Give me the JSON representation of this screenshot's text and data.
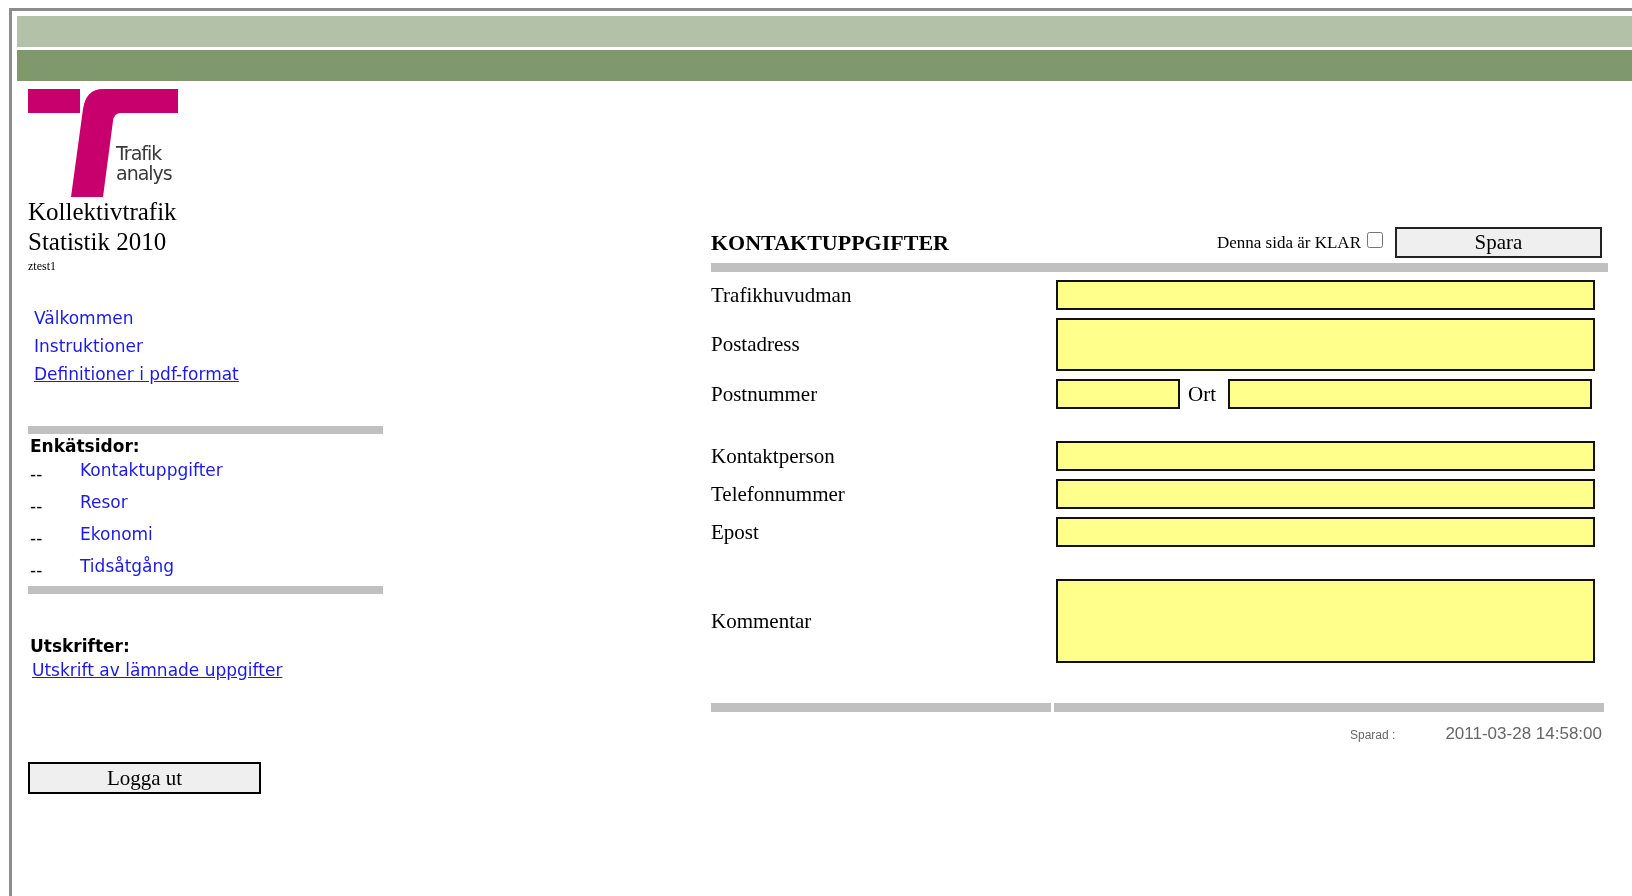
{
  "logo": {
    "line_1": "Trafik",
    "line_2": "analys"
  },
  "app_title": [
    "Kollektivtrafik",
    "Statistik 2010"
  ],
  "user": "ztest1",
  "nav_links": [
    {
      "label": "Välkommen",
      "underlined": false
    },
    {
      "label": "Instruktioner",
      "underlined": false
    },
    {
      "label": "Definitioner i pdf-format",
      "underlined": true
    }
  ],
  "survey_pages": {
    "heading": "Enkätsidor:",
    "items": [
      {
        "bullet": "--",
        "label": "Kontaktuppgifter"
      },
      {
        "bullet": "--",
        "label": "Resor"
      },
      {
        "bullet": "--",
        "label": "Ekonomi"
      },
      {
        "bullet": "--",
        "label": "Tidsåtgång"
      }
    ]
  },
  "printouts": {
    "heading": "Utskrifter:",
    "links": [
      {
        "label": "Utskrift av lämnade uppgifter",
        "underlined": true
      }
    ]
  },
  "logout_button": "Logga ut",
  "form": {
    "title": "KONTAKTUPPGIFTER",
    "ready_label": "Denna sida är KLAR",
    "ready_checked": false,
    "save_button": "Spara",
    "row_groups": [
      [
        {
          "kind": "text",
          "label": "Trafikhuvudman"
        },
        {
          "kind": "textarea",
          "label": "Postadress"
        },
        {
          "kind": "split",
          "label": "Postnummer",
          "inner_label": "Ort"
        }
      ],
      [
        {
          "kind": "text",
          "label": "Kontaktperson"
        },
        {
          "kind": "text",
          "label": "Telefonnummer"
        },
        {
          "kind": "text",
          "label": "Epost"
        }
      ],
      [
        {
          "kind": "textarea_tall",
          "label": "Kommentar"
        }
      ]
    ]
  },
  "saved": {
    "label": "Sparad :",
    "timestamp": "2011-03-28 14:58:00"
  }
}
